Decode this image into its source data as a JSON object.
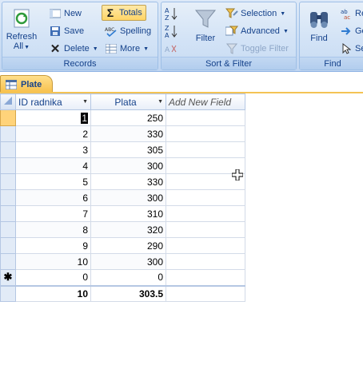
{
  "ribbon": {
    "records": {
      "title": "Records",
      "refresh_line1": "Refresh",
      "refresh_line2": "All",
      "new_label": "New",
      "save_label": "Save",
      "delete_label": "Delete",
      "totals_label": "Totals",
      "spelling_label": "Spelling",
      "more_label": "More"
    },
    "sort_filter": {
      "title": "Sort & Filter",
      "filter_label": "Filter",
      "selection_label": "Selection",
      "advanced_label": "Advanced",
      "toggle_filter_label": "Toggle Filter"
    },
    "find": {
      "title": "Find",
      "find_label": "Find",
      "replace_label": "Re",
      "goto_label": "Go",
      "select_label": "Se"
    }
  },
  "tab": {
    "label": "Plate"
  },
  "table": {
    "columns": [
      "ID radnika",
      "Plata",
      "Add New Field"
    ],
    "rows": [
      {
        "id": "1",
        "plata": "250"
      },
      {
        "id": "2",
        "plata": "330"
      },
      {
        "id": "3",
        "plata": "305"
      },
      {
        "id": "4",
        "plata": "300"
      },
      {
        "id": "5",
        "plata": "330"
      },
      {
        "id": "6",
        "plata": "300"
      },
      {
        "id": "7",
        "plata": "310"
      },
      {
        "id": "8",
        "plata": "320"
      },
      {
        "id": "9",
        "plata": "290"
      },
      {
        "id": "10",
        "plata": "300"
      }
    ],
    "new_row": {
      "marker": "✱",
      "id": "0",
      "plata": "0"
    },
    "totals": {
      "id": "10",
      "plata": "303.5"
    }
  },
  "colors": {
    "ribbon_bg": "#c9dcf3",
    "accent_text": "#15428b",
    "active_tab": "#f7c14c",
    "current_row": "#ffd37a"
  }
}
